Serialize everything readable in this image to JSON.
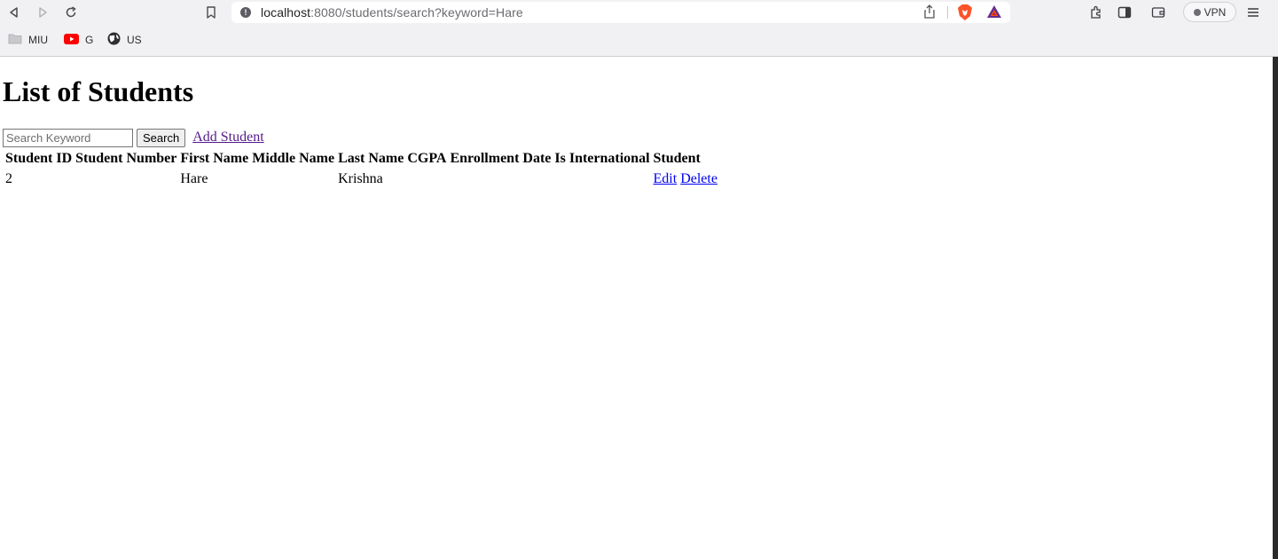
{
  "browser": {
    "url_host": "localhost",
    "url_rest": ":8080/students/search?keyword=Hare",
    "vpn_label": "VPN",
    "bookmarks": [
      {
        "label": "MIU",
        "icon": "folder-icon"
      },
      {
        "label": "G",
        "icon": "youtube-icon"
      },
      {
        "label": "US",
        "icon": "globe-icon"
      }
    ]
  },
  "page": {
    "title": "List of Students",
    "search": {
      "placeholder": "Search Keyword",
      "value": "",
      "button_label": "Search"
    },
    "add_link": "Add Student",
    "table": {
      "headers": [
        "Student ID",
        "Student Number",
        "First Name",
        "Middle Name",
        "Last Name",
        "CGPA",
        "Enrollment Date",
        "Is International",
        "Student"
      ],
      "rows": [
        {
          "student_id": "2",
          "student_number": "",
          "first_name": "Hare",
          "middle_name": "",
          "last_name": "Krishna",
          "cgpa": "",
          "enrollment_date": "",
          "is_international": "",
          "edit_label": "Edit",
          "delete_label": "Delete"
        }
      ]
    }
  },
  "colors": {
    "visited_link": "#551a8b",
    "link": "#0000ee",
    "youtube_red": "#ff0000",
    "brave_orange": "#fb542b"
  }
}
